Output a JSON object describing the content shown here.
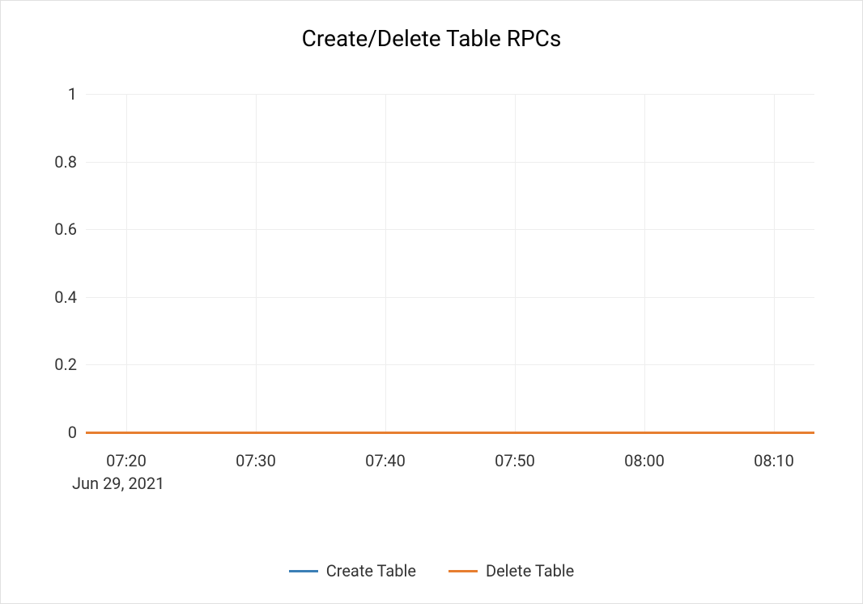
{
  "chart_data": {
    "type": "line",
    "title": "Create/Delete Table RPCs",
    "xlabel": "",
    "ylabel": "",
    "ylim": [
      0,
      1
    ],
    "x_categories": [
      "07:20",
      "07:30",
      "07:40",
      "07:50",
      "08:00",
      "08:10"
    ],
    "date_label": "Jun 29, 2021",
    "y_ticks": [
      "0",
      "0.2",
      "0.4",
      "0.6",
      "0.8",
      "1"
    ],
    "series": [
      {
        "name": "Create Table",
        "color": "#3b7fb6",
        "values": [
          0,
          0,
          0,
          0,
          0,
          0
        ]
      },
      {
        "name": "Delete Table",
        "color": "#e77e30",
        "values": [
          0,
          0,
          0,
          0,
          0,
          0
        ]
      }
    ]
  }
}
